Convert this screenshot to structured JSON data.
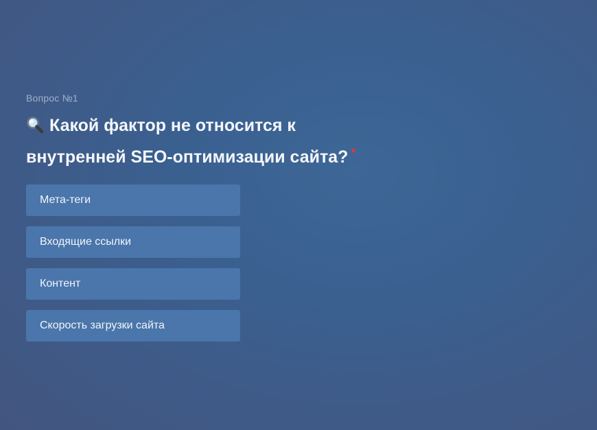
{
  "question": {
    "number_label": "Вопрос №1",
    "icon": "magnifier-icon",
    "text": "Какой фактор не относится к внутренней SEO-оптимизации сайта?",
    "required_marker": "*"
  },
  "answers": [
    {
      "label": "Мета-теги"
    },
    {
      "label": "Входящие ссылки"
    },
    {
      "label": "Контент"
    },
    {
      "label": "Скорость загрузки сайта"
    }
  ],
  "colors": {
    "background": "#3d6392",
    "answer_background": "#4a76ab",
    "required_marker": "#e03a3a"
  }
}
